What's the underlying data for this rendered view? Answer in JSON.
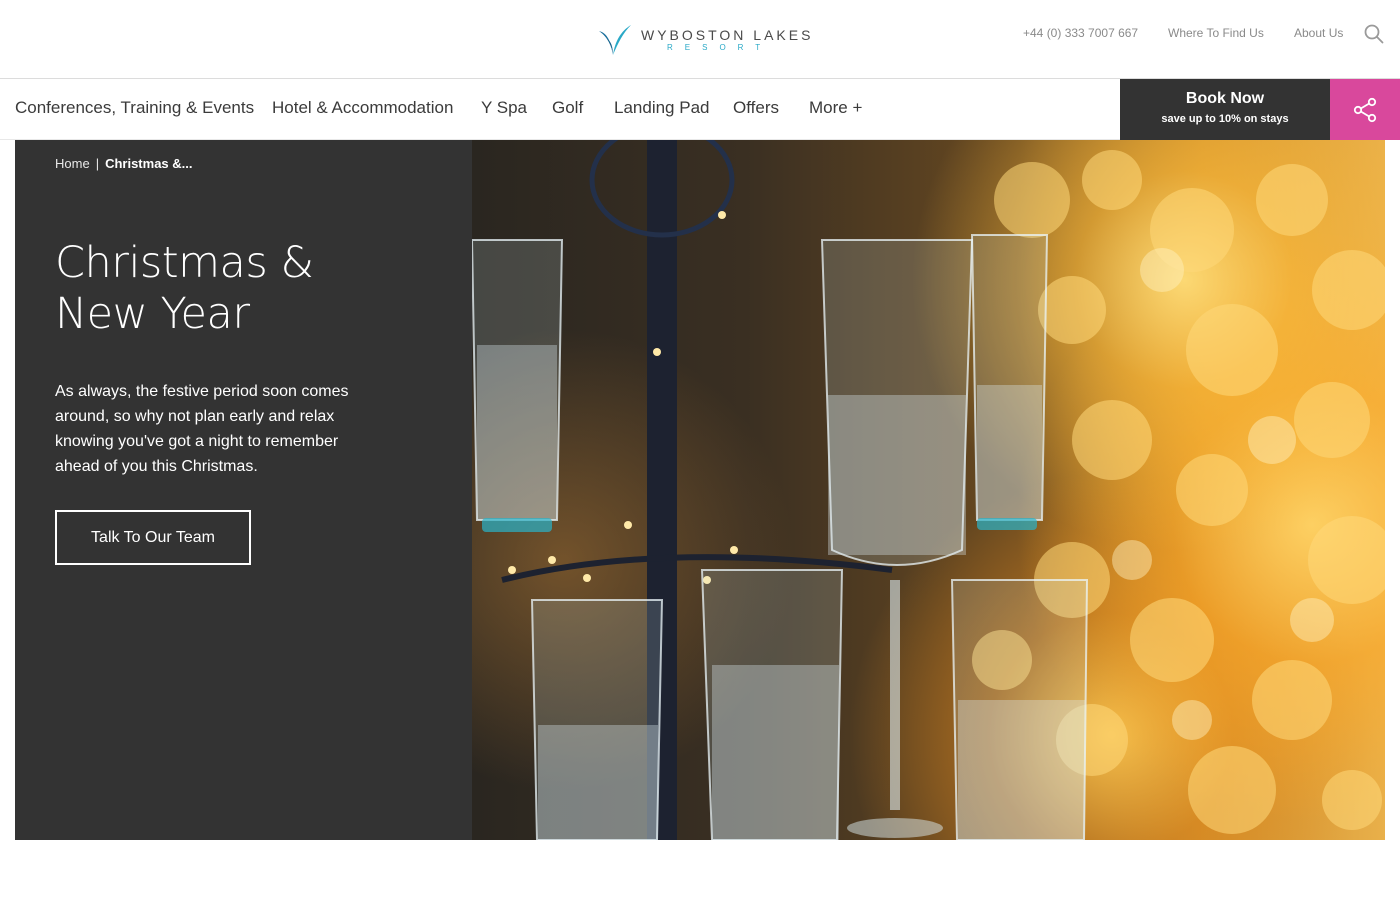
{
  "header": {
    "logo": {
      "name": "WYBOSTON LAKES",
      "subtitle": "RESORT"
    },
    "phone": "+44 (0) 333 7007 667",
    "where_to_find_us": "Where To Find Us",
    "about_us": "About Us"
  },
  "nav": {
    "items": [
      {
        "label": "Conferences, Training & Events"
      },
      {
        "label": "Hotel & Accommodation"
      },
      {
        "label": "Y Spa"
      },
      {
        "label": "Golf"
      },
      {
        "label": "Landing Pad"
      },
      {
        "label": "Offers"
      },
      {
        "label": "More +"
      }
    ],
    "book": {
      "title": "Book Now",
      "subtitle": "save up to 10% on stays"
    }
  },
  "hero": {
    "breadcrumb": {
      "home": "Home",
      "separator": "|",
      "current": "Christmas &..."
    },
    "title": "Christmas & New Year",
    "description": "As always, the festive period soon comes around, so why not plan early and relax knowing you've got a night to remember ahead of you this Christmas.",
    "cta": "Talk To Our Team"
  },
  "colors": {
    "panel": "#333333",
    "book_button": "#333333",
    "share_button": "#d9489c",
    "logo_accent": "#2aa9c7"
  },
  "icons": {
    "search": "search-icon",
    "share": "share-icon",
    "logo_mark": "wyboston-logo-mark"
  }
}
